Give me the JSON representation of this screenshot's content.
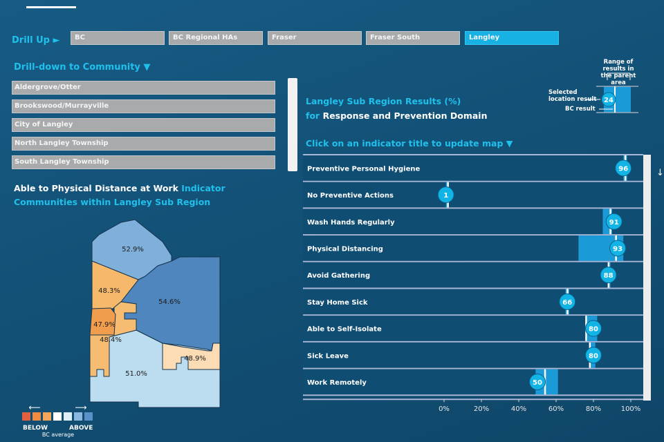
{
  "header": {
    "drill_up": "Drill Up ►",
    "breadcrumbs": [
      {
        "label": "BC"
      },
      {
        "label": "BC Regional HAs"
      },
      {
        "label": "Fraser"
      },
      {
        "label": "Fraser South"
      },
      {
        "label": "Langley",
        "active": true
      }
    ]
  },
  "drilldown": {
    "title": "Drill-down to Community ▼",
    "items": [
      "Aldergrove/Otter",
      "Brookswood/Murrayville",
      "City of Langley",
      "North Langley Township",
      "South Langley Township"
    ]
  },
  "map": {
    "title_part1": "Able to Physical Distance at Work",
    "title_part2": "Indicator",
    "subtitle": "Communities within Langley Sub Region",
    "regions": [
      {
        "label": "51.0%",
        "color": "#bcdcf0"
      },
      {
        "label": "52.9%",
        "color": "#7fb0dc"
      },
      {
        "label": "54.6%",
        "color": "#4f86be"
      },
      {
        "label": "48.3%",
        "color": "#f6b96b"
      },
      {
        "label": "48.4%",
        "color": "#f6bd72"
      },
      {
        "label": "47.9%",
        "color": "#f09d4e"
      },
      {
        "label": "48.9%",
        "color": "#fbdcb4"
      }
    ],
    "legend": {
      "colors": [
        "#e0603f",
        "#ef8a40",
        "#f4a55a",
        "#ffffff",
        "#ddeef8",
        "#8ab8e0",
        "#5a90c8"
      ],
      "below": "BELOW",
      "above": "ABOVE",
      "caption": "BC average"
    }
  },
  "results": {
    "title_line1": "Langley Sub Region Results (%)",
    "for": "for",
    "domain": "Response and Prevention Domain",
    "instruction": "Click on an indicator title to update map ▼"
  },
  "key": {
    "range_line1": "Range of results in",
    "range_line2": "the parent area",
    "selected_line1": "Selected",
    "selected_line2": "location result",
    "bc_result": "BC result",
    "sample_value": "24"
  },
  "colors": {
    "accent": "#1fc0ec",
    "range_bar": "#1a9ad6",
    "marker": "#12b4e6"
  },
  "chart_data": {
    "type": "range-dot",
    "xlim": [
      0,
      100
    ],
    "ticks": [
      "0%",
      "20%",
      "40%",
      "60%",
      "80%",
      "100%"
    ],
    "rows": [
      {
        "label": "Preventive Personal Hygiene",
        "value": 96,
        "bc": 97,
        "range": [
          96,
          98
        ]
      },
      {
        "label": "No Preventive Actions",
        "value": 1,
        "bc": 2,
        "range": [
          1,
          2
        ]
      },
      {
        "label": "Wash Hands Regularly",
        "value": 91,
        "bc": 89,
        "range": [
          85,
          90
        ]
      },
      {
        "label": "Physical Distancing",
        "value": 93,
        "bc": 92,
        "range": [
          72,
          96
        ]
      },
      {
        "label": "Avoid Gathering",
        "value": 88,
        "bc": 88,
        "range": [
          88,
          89
        ]
      },
      {
        "label": "Stay Home Sick",
        "value": 66,
        "bc": 66,
        "range": [
          65,
          67
        ]
      },
      {
        "label": "Able to Self-Isolate",
        "value": 80,
        "bc": 76,
        "range": [
          76,
          82
        ]
      },
      {
        "label": "Sick Leave",
        "value": 80,
        "bc": 78,
        "range": [
          78,
          81
        ]
      },
      {
        "label": "Work Remotely",
        "value": 50,
        "bc": 54,
        "range": [
          49,
          61
        ]
      }
    ]
  }
}
